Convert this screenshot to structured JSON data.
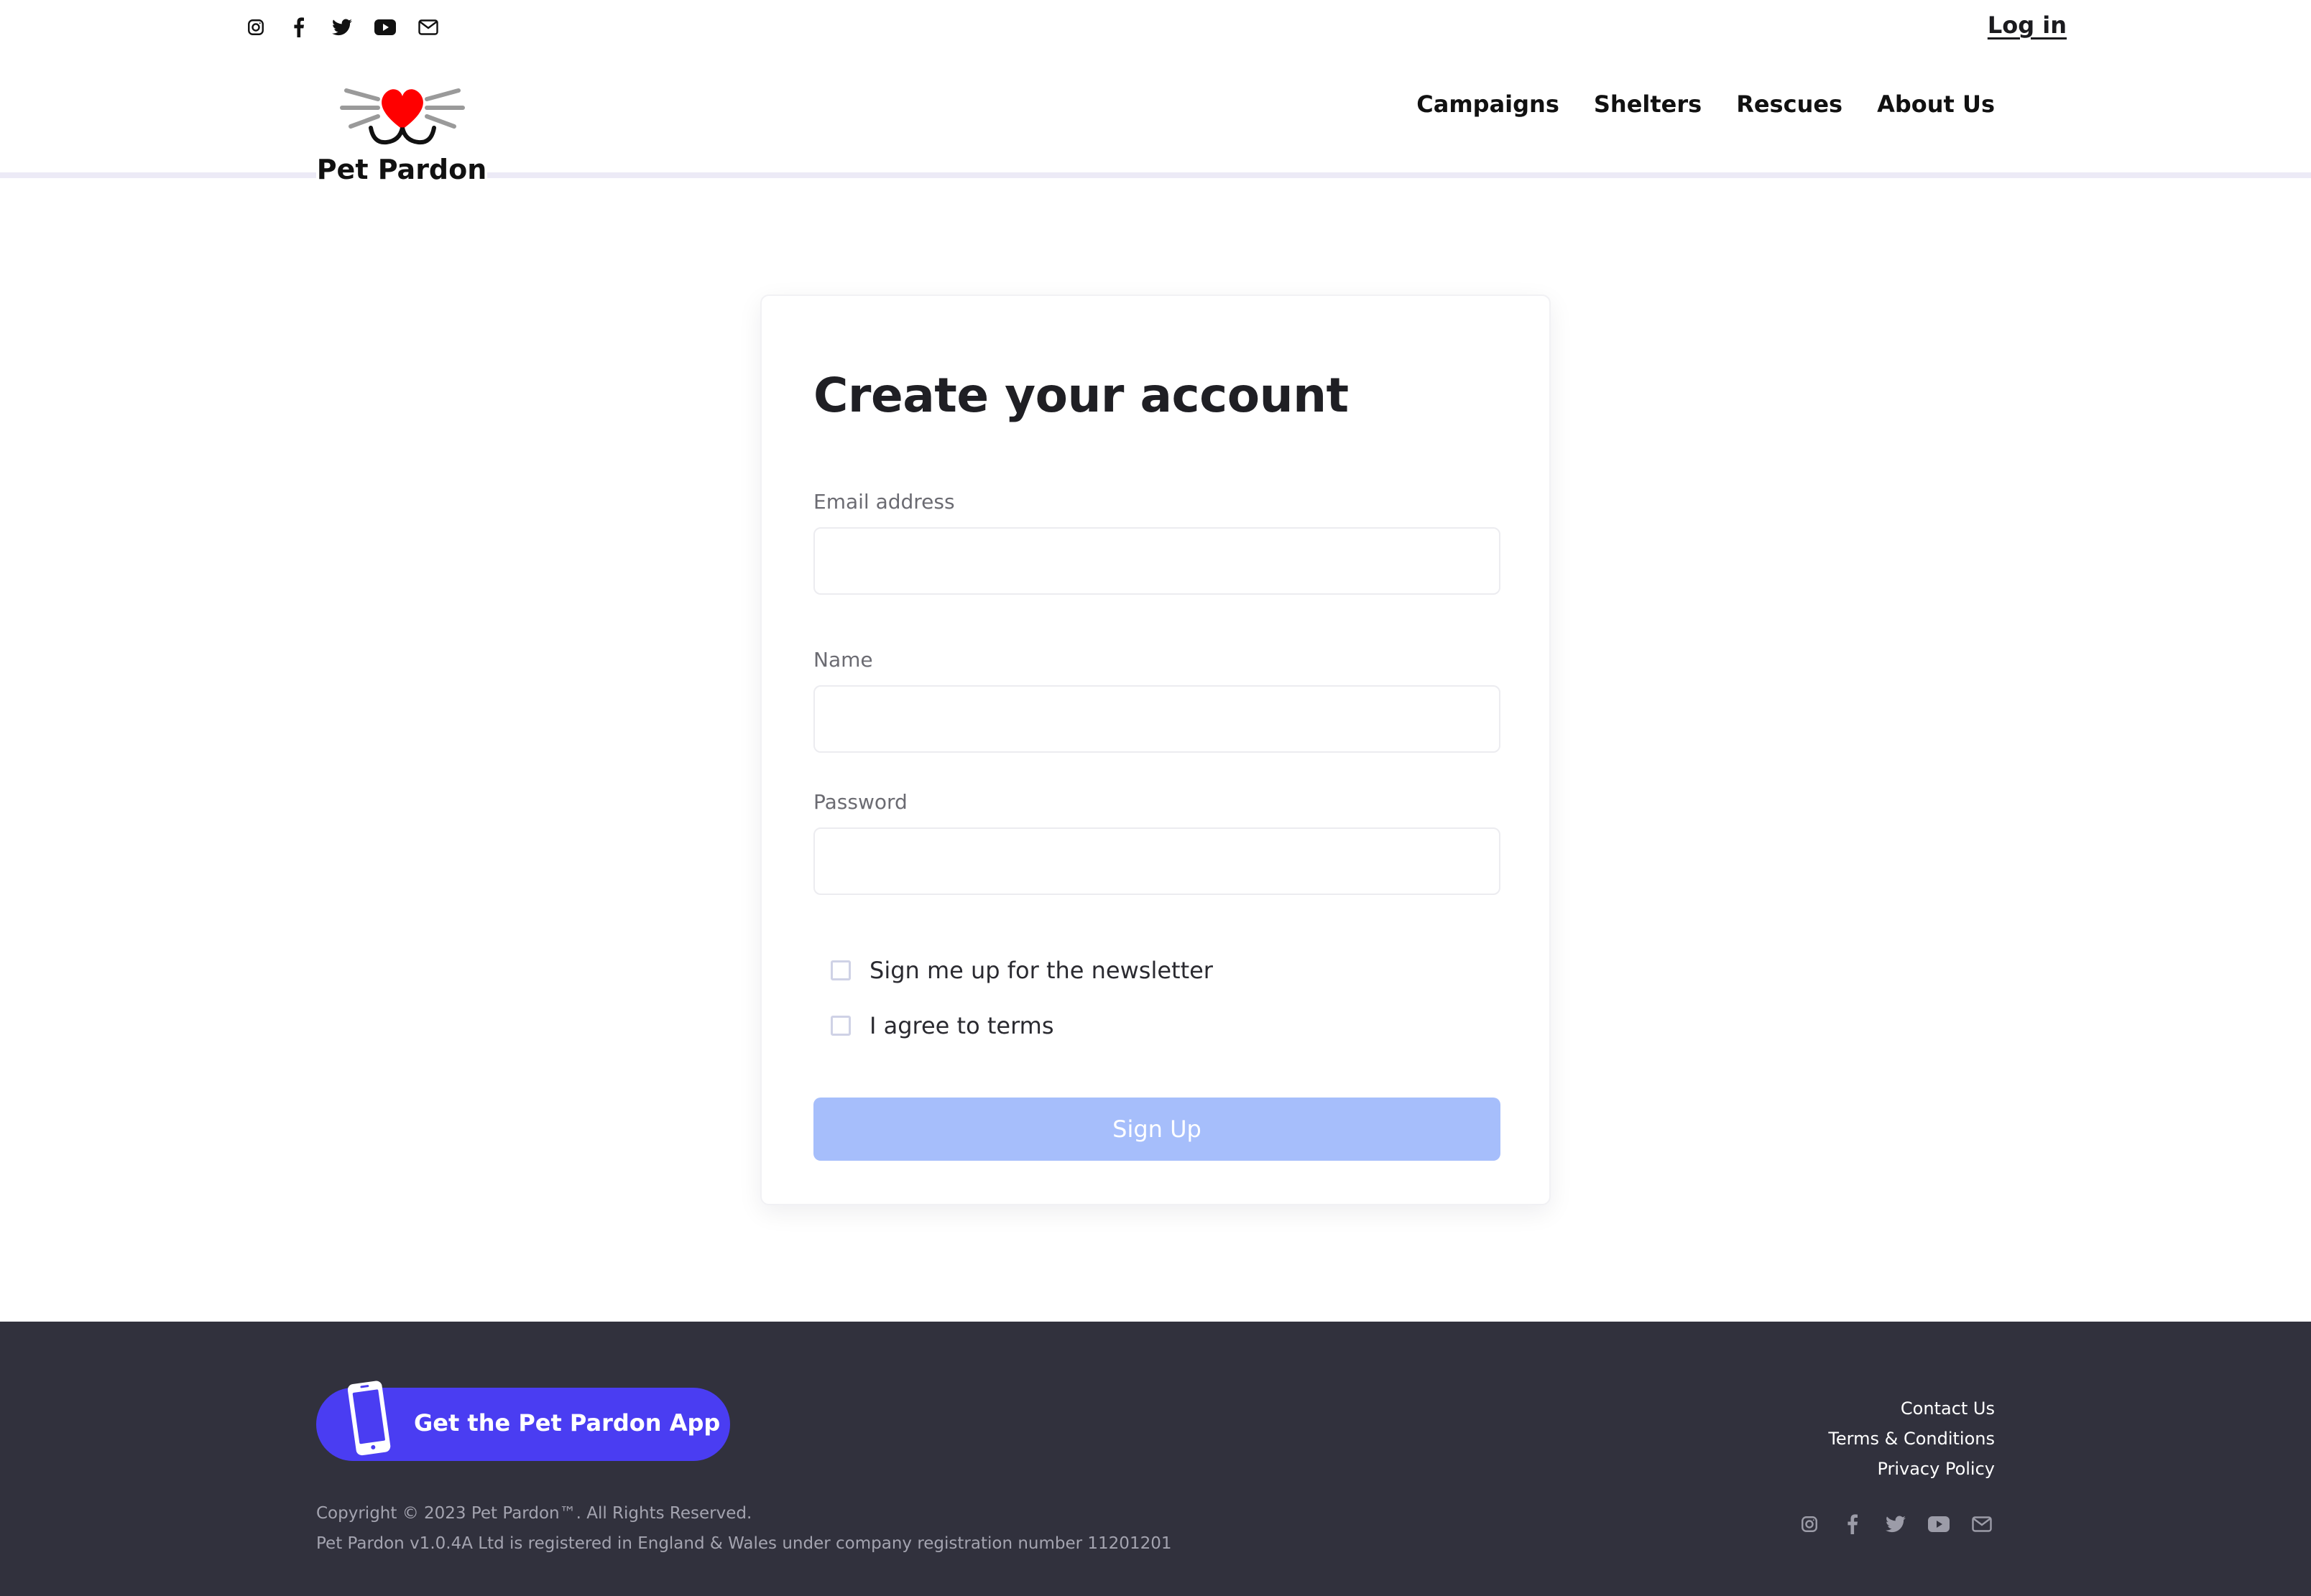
{
  "colors": {
    "accent": "#4a3df2",
    "button_disabled": "#a6befb",
    "footer_bg": "#31313d",
    "logo_heart": "#ff0000",
    "header_rule": "#eceaf6"
  },
  "header": {
    "social_icons": [
      "instagram-icon",
      "facebook-icon",
      "twitter-icon",
      "youtube-icon",
      "mail-icon"
    ],
    "login_label": "Log in",
    "logo_text": "Pet Pardon",
    "nav": [
      {
        "label": "Campaigns"
      },
      {
        "label": "Shelters"
      },
      {
        "label": "Rescues"
      },
      {
        "label": "About Us"
      }
    ]
  },
  "form": {
    "title": "Create your account",
    "email_label": "Email address",
    "email_value": "",
    "name_label": "Name",
    "name_value": "",
    "password_label": "Password",
    "password_value": "",
    "newsletter_label": "Sign me up for the newsletter",
    "newsletter_checked": false,
    "terms_label": "I agree to terms",
    "terms_checked": false,
    "submit_label": "Sign Up"
  },
  "footer": {
    "app_button_label": "Get the Pet Pardon App",
    "copyright_line1": "Copyright © 2023 Pet Pardon™. All Rights Reserved.",
    "copyright_line2": "Pet Pardon v1.0.4A Ltd is registered in England & Wales under company registration number 11201201",
    "links": [
      {
        "label": "Contact Us"
      },
      {
        "label": "Terms & Conditions"
      },
      {
        "label": "Privacy Policy"
      }
    ],
    "social_icons": [
      "instagram-icon",
      "facebook-icon",
      "twitter-icon",
      "youtube-icon",
      "mail-icon"
    ]
  }
}
